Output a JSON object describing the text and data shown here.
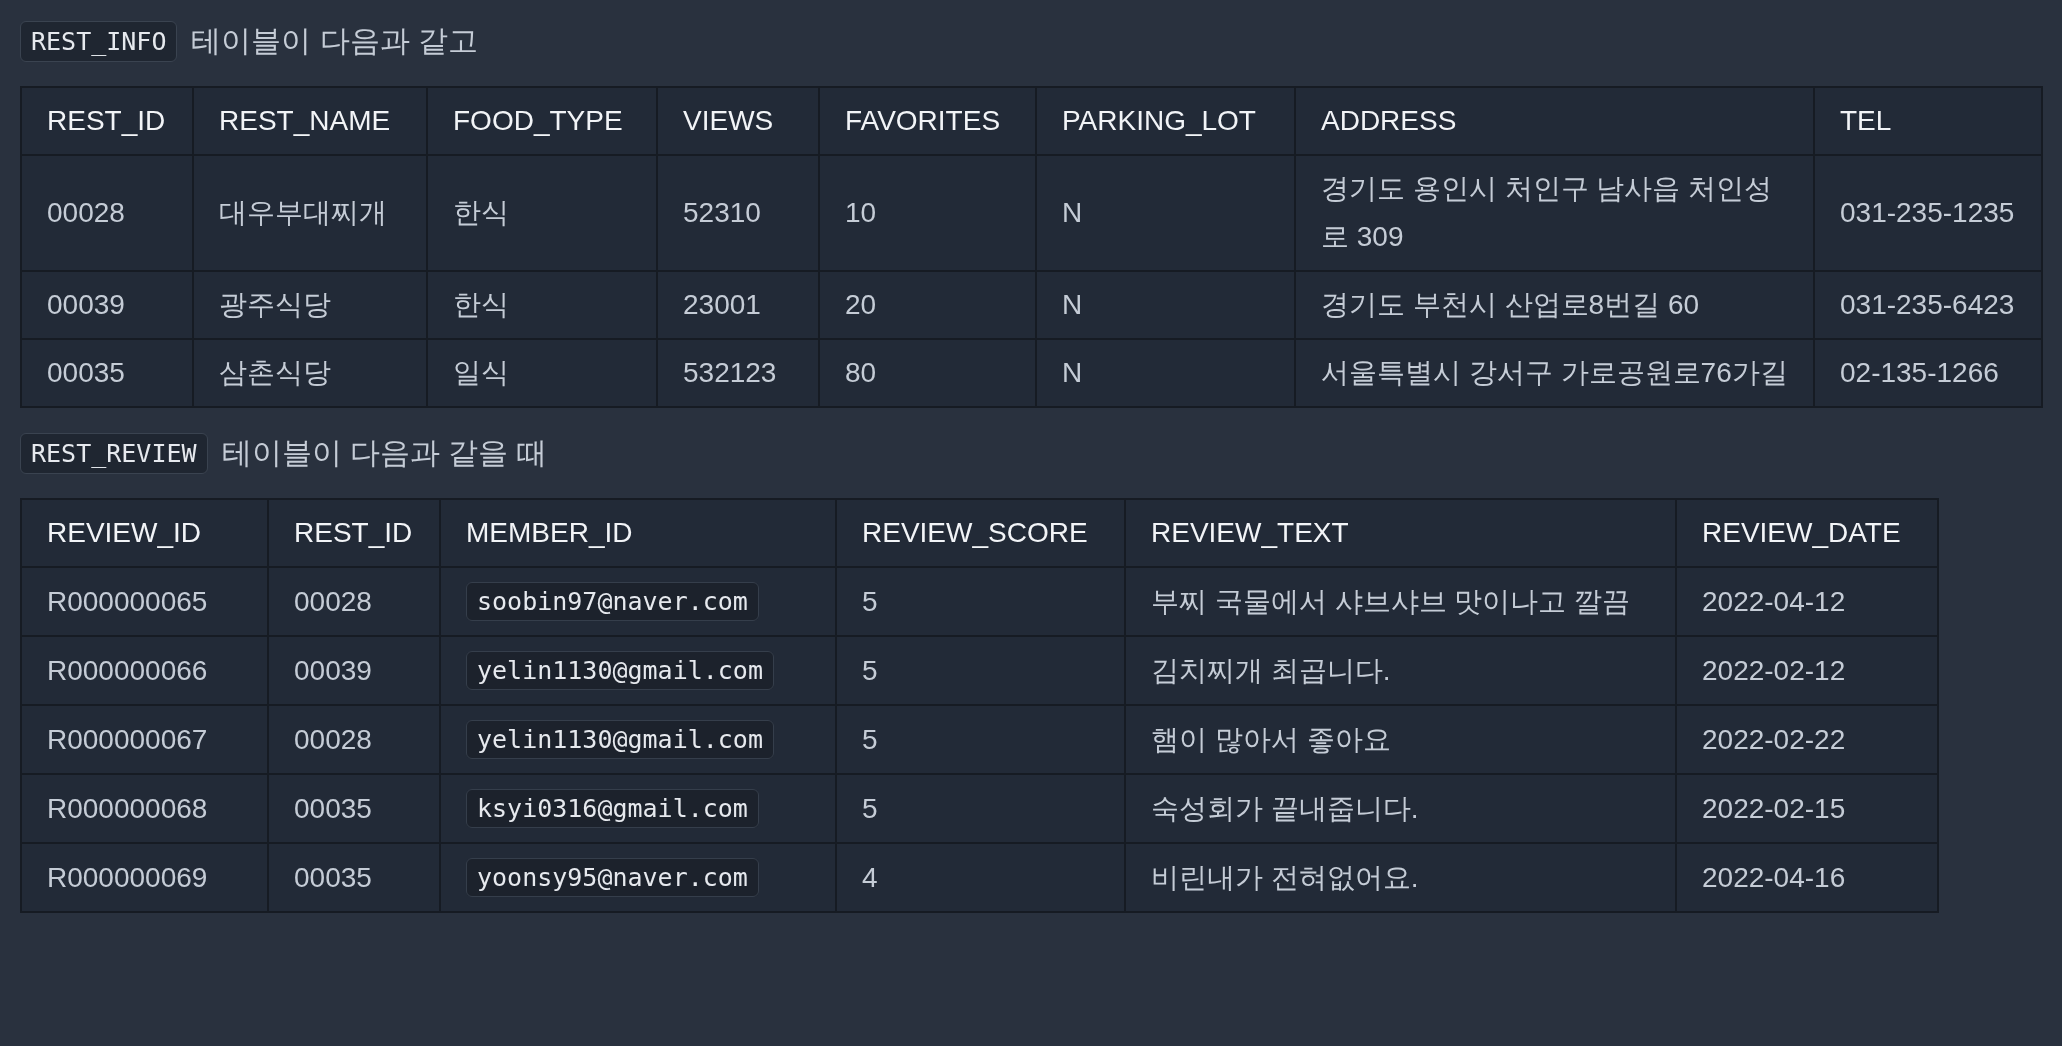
{
  "sections": [
    {
      "table_name": "REST_INFO",
      "caption": "테이블이 다음과 같고",
      "columns": [
        {
          "label": "REST_ID",
          "kind": "text"
        },
        {
          "label": "REST_NAME",
          "kind": "text"
        },
        {
          "label": "FOOD_TYPE",
          "kind": "text"
        },
        {
          "label": "VIEWS",
          "kind": "text"
        },
        {
          "label": "FAVORITES",
          "kind": "text"
        },
        {
          "label": "PARKING_LOT",
          "kind": "text"
        },
        {
          "label": "ADDRESS",
          "kind": "text"
        },
        {
          "label": "TEL",
          "kind": "text"
        }
      ],
      "rows": [
        [
          "00028",
          "대우부대찌개",
          "한식",
          "52310",
          "10",
          "N",
          "경기도 용인시 처인구 남사읍 처인성로 309",
          "031-235-1235"
        ],
        [
          "00039",
          "광주식당",
          "한식",
          "23001",
          "20",
          "N",
          "경기도 부천시 산업로8번길 60",
          "031-235-6423"
        ],
        [
          "00035",
          "삼촌식당",
          "일식",
          "532123",
          "80",
          "N",
          "서울특별시 강서구 가로공원로76가길",
          "02-135-1266"
        ]
      ]
    },
    {
      "table_name": "REST_REVIEW",
      "caption": "테이블이 다음과 같을 때",
      "columns": [
        {
          "label": "REVIEW_ID",
          "kind": "text"
        },
        {
          "label": "REST_ID",
          "kind": "text"
        },
        {
          "label": "MEMBER_ID",
          "kind": "code"
        },
        {
          "label": "REVIEW_SCORE",
          "kind": "text"
        },
        {
          "label": "REVIEW_TEXT",
          "kind": "text"
        },
        {
          "label": "REVIEW_DATE",
          "kind": "text"
        }
      ],
      "rows": [
        [
          "R000000065",
          "00028",
          "soobin97@naver.com",
          "5",
          "부찌 국물에서 샤브샤브 맛이나고 깔끔",
          "2022-04-12"
        ],
        [
          "R000000066",
          "00039",
          "yelin1130@gmail.com",
          "5",
          "김치찌개 최곱니다.",
          "2022-02-12"
        ],
        [
          "R000000067",
          "00028",
          "yelin1130@gmail.com",
          "5",
          "햄이 많아서 좋아요",
          "2022-02-22"
        ],
        [
          "R000000068",
          "00035",
          "ksyi0316@gmail.com",
          "5",
          "숙성회가 끝내줍니다.",
          "2022-02-15"
        ],
        [
          "R000000069",
          "00035",
          "yoonsy95@naver.com",
          "4",
          "비린내가 전혀없어요.",
          "2022-04-16"
        ]
      ]
    }
  ]
}
